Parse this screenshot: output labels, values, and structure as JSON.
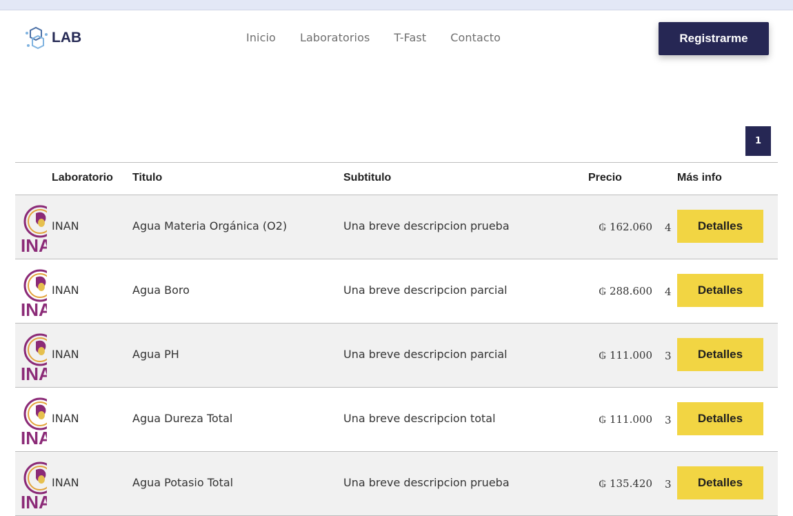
{
  "header": {
    "logo_text": "LAB",
    "nav": [
      "Inicio",
      "Laboratorios",
      "T-Fast",
      "Contacto"
    ],
    "register_label": "Registrarme"
  },
  "pagination": {
    "current": "1"
  },
  "table": {
    "columns": [
      "Laboratorio",
      "Titulo",
      "Subtitulo",
      "Precio",
      "Más info"
    ],
    "rows": [
      {
        "lab": "INAN",
        "title": "Agua Materia Orgánica (O2)",
        "subtitle": "Una breve descripcion prueba",
        "price": "₲ 162.060",
        "stock": "4",
        "action": "Detalles"
      },
      {
        "lab": "INAN",
        "title": "Agua Boro",
        "subtitle": "Una breve descripcion parcial",
        "price": "₲ 288.600",
        "stock": "4",
        "action": "Detalles"
      },
      {
        "lab": "INAN",
        "title": "Agua PH",
        "subtitle": "Una breve descripcion parcial",
        "price": "₲ 111.000",
        "stock": "3",
        "action": "Detalles"
      },
      {
        "lab": "INAN",
        "title": "Agua Dureza Total",
        "subtitle": "Una breve descripcion total",
        "price": "₲ 111.000",
        "stock": "3",
        "action": "Detalles"
      },
      {
        "lab": "INAN",
        "title": "Agua Potasio Total",
        "subtitle": "Una breve descripcion prueba",
        "price": "₲ 135.420",
        "stock": "3",
        "action": "Detalles"
      }
    ]
  },
  "colors": {
    "primary": "#262754",
    "accent": "#f2d543",
    "row_alt": "#f1f1f1"
  },
  "icons": {
    "logo": "molecule-icon",
    "thumbnail": "inan-logo-icon"
  }
}
